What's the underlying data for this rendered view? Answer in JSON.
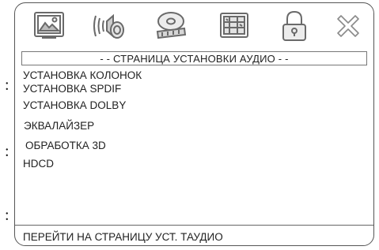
{
  "toolbar": {
    "tabs": [
      {
        "icon": "general-settings-icon"
      },
      {
        "icon": "audio-settings-icon"
      },
      {
        "icon": "video-settings-icon"
      },
      {
        "icon": "preferences-icon"
      },
      {
        "icon": "password-lock-icon"
      },
      {
        "icon": "exit-icon"
      }
    ]
  },
  "page": {
    "header": "- - СТРАНИЦА УСТАНОВКИ АУДИО - -",
    "items": [
      "УСТАНОВКА КОЛОНОК",
      "УСТАНОВКА SPDIF",
      "УСТАНОВКА DOLBY",
      "ЭКВАЛАЙЗЕР",
      "ОБРАБОТКА 3D",
      "HDCD"
    ],
    "footer": "ПЕРЕЙТИ НА СТРАНИЦУ УСТ. ТАУДИО"
  },
  "side_marks": [
    ":",
    ":",
    ":"
  ],
  "colors": {
    "border": "#555555",
    "text": "#222222",
    "icon": "#6a6a6a"
  }
}
